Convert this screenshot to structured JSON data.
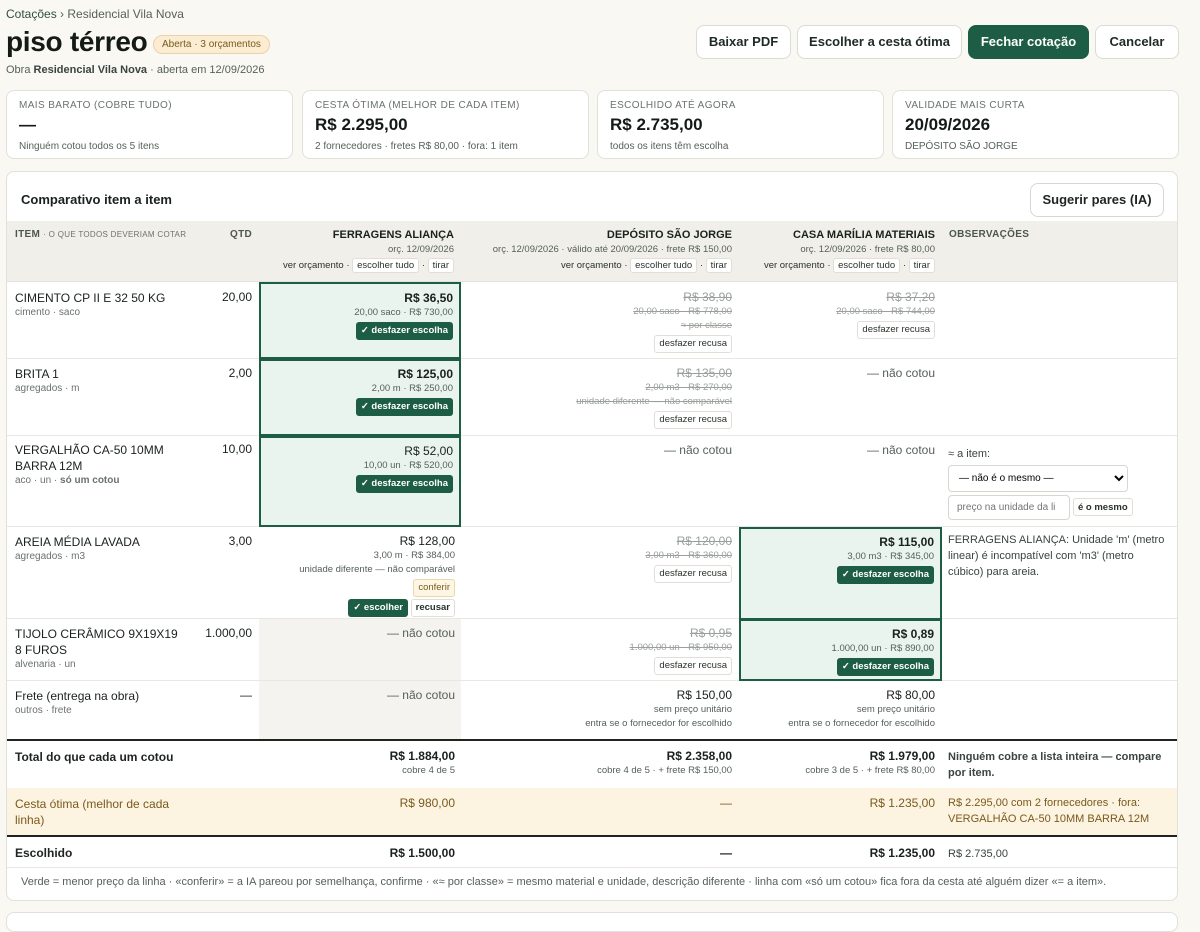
{
  "breadcrumb": {
    "root": "Cotações",
    "sep": "›",
    "current": "Residencial Vila Nova"
  },
  "page": {
    "title": "piso térreo",
    "status_badge": "Aberta · 3 orçamentos",
    "sub_prefix": "Obra",
    "sub_obra": "Residencial Vila Nova",
    "sub_suffix": "· aberta em 12/09/2026"
  },
  "actions": {
    "pdf": "Baixar PDF",
    "best": "Escolher a cesta ótima",
    "close": "Fechar cotação",
    "cancel": "Cancelar"
  },
  "summary": [
    {
      "label": "MAIS BARATO (COBRE TUDO)",
      "value": "—",
      "detail": "Ninguém cotou todos os 5 itens"
    },
    {
      "label": "CESTA ÓTIMA (MELHOR DE CADA ITEM)",
      "value": "R$ 2.295,00",
      "detail": "2 fornecedores · fretes R$ 80,00 · fora: 1 item"
    },
    {
      "label": "ESCOLHIDO ATÉ AGORA",
      "value": "R$ 2.735,00",
      "detail": "todos os itens têm escolha"
    },
    {
      "label": "VALIDADE MAIS CURTA",
      "value": "20/09/2026",
      "detail": "DEPÓSITO SÃO JORGE"
    }
  ],
  "panel": {
    "title": "Comparativo item a item",
    "suggest": "Sugerir pares (IA)"
  },
  "header": {
    "item": "ITEM",
    "item_hint": "· O QUE TODOS DEVERIAM COTAR",
    "qty": "QTD",
    "obs": "OBSERVAÇÕES"
  },
  "suppliers": [
    {
      "name": "FERRAGENS ALIANÇA",
      "meta": "orç. 12/09/2026",
      "view": "ver orçamento",
      "dot": "·",
      "all": "escolher tudo",
      "remove": "tirar"
    },
    {
      "name": "DEPÓSITO SÃO JORGE",
      "meta": "orç. 12/09/2026 · válido até 20/09/2026 · frete R$ 150,00",
      "view": "ver orçamento",
      "dot": "·",
      "all": "escolher tudo",
      "remove": "tirar"
    },
    {
      "name": "CASA MARÍLIA MATERIAIS",
      "meta": "orç. 12/09/2026 · frete R$ 80,00",
      "view": "ver orçamento",
      "dot": "·",
      "all": "escolher tudo",
      "remove": "tirar"
    }
  ],
  "rows": {
    "cimento": {
      "name": "CIMENTO CP II E 32 50 KG",
      "cat": "cimento · saco",
      "qty": "20,00",
      "s1": {
        "price": "R$ 36,50",
        "detail": "20,00 saco · R$ 730,00",
        "action": "✓ desfazer escolha"
      },
      "s2": {
        "price": "R$ 38,90",
        "detail": "20,00 saco · R$ 778,00",
        "note": "≈ por classe",
        "action": "desfazer recusa"
      },
      "s3": {
        "price": "R$ 37,20",
        "detail": "20,00 saco · R$ 744,00",
        "action": "desfazer recusa"
      }
    },
    "brita": {
      "name": "BRITA 1",
      "cat": "agregados · m",
      "qty": "2,00",
      "s1": {
        "price": "R$ 125,00",
        "detail": "2,00 m · R$ 250,00",
        "action": "✓ desfazer escolha"
      },
      "s2": {
        "price": "R$ 135,00",
        "detail": "2,00 m3 · R$ 270,00",
        "note": "unidade diferente — não comparável",
        "action": "desfazer recusa"
      },
      "s3": {
        "none": "— não cotou"
      }
    },
    "vergalhao": {
      "name": "VERGALHÃO CA-50 10MM BARRA 12M",
      "cat": "aco · un ·",
      "cat_bold": "só um cotou",
      "qty": "10,00",
      "s1": {
        "price": "R$ 52,00",
        "detail": "10,00 un · R$ 520,00",
        "action": "✓ desfazer escolha"
      },
      "s2": {
        "none": "— não cotou"
      },
      "s3": {
        "none": "— não cotou"
      },
      "obs": {
        "label": "≈ a item:",
        "select": "— não é o mesmo —",
        "placeholder": "preço na unidade da li",
        "btn": "é o mesmo"
      }
    },
    "areia": {
      "name": "AREIA MÉDIA LAVADA",
      "cat": "agregados · m3",
      "qty": "3,00",
      "s1": {
        "price": "R$ 128,00",
        "detail": "3,00 m · R$ 384,00",
        "note": "unidade diferente — não comparável",
        "confirm": "conferir",
        "choose": "✓ escolher",
        "refuse": "recusar"
      },
      "s2": {
        "price": "R$ 120,00",
        "detail": "3,00 m3 · R$ 360,00",
        "action": "desfazer recusa"
      },
      "s3": {
        "price": "R$ 115,00",
        "detail": "3,00 m3 · R$ 345,00",
        "action": "✓ desfazer escolha"
      },
      "obs": "FERRAGENS ALIANÇA: Unidade 'm' (metro linear) é incompatível com 'm3' (metro cúbico) para areia."
    },
    "tijolo": {
      "name": "TIJOLO CERÂMICO 9X19X19 8 FUROS",
      "cat": "alvenaria · un",
      "qty": "1.000,00",
      "s1": {
        "none": "— não cotou"
      },
      "s2": {
        "price": "R$ 0,95",
        "detail": "1.000,00 un · R$ 950,00",
        "action": "desfazer recusa"
      },
      "s3": {
        "price": "R$ 0,89",
        "detail": "1.000,00 un · R$ 890,00",
        "action": "✓ desfazer escolha"
      }
    },
    "frete": {
      "name": "Frete (entrega na obra)",
      "cat": "outros · frete",
      "qty": "—",
      "s1": {
        "none": "— não cotou"
      },
      "s2": {
        "price": "R$ 150,00",
        "l1": "sem preço unitário",
        "l2": "entra se o fornecedor for escolhido"
      },
      "s3": {
        "price": "R$ 80,00",
        "l1": "sem preço unitário",
        "l2": "entra se o fornecedor for escolhido"
      }
    }
  },
  "totals": {
    "label": "Total do que cada um cotou",
    "s1": {
      "value": "R$ 1.884,00",
      "detail": "cobre 4 de 5"
    },
    "s2": {
      "value": "R$ 2.358,00",
      "detail": "cobre 4 de 5 · + frete R$ 150,00"
    },
    "s3": {
      "value": "R$ 1.979,00",
      "detail": "cobre 3 de 5 · + frete R$ 80,00"
    },
    "obs": "Ninguém cobre a lista inteira — compare por item."
  },
  "best": {
    "label": "Cesta ótima (melhor de cada linha)",
    "s1": "R$ 980,00",
    "s2": "—",
    "s3": "R$ 1.235,00",
    "obs": "R$ 2.295,00 com 2 fornecedores · fora: VERGALHÃO CA-50 10MM BARRA 12M"
  },
  "chosen": {
    "label": "Escolhido",
    "s1": "R$ 1.500,00",
    "s2": "—",
    "s3": "R$ 1.235,00",
    "obs": "R$ 2.735,00"
  },
  "footer": "Verde = menor preço da linha · «conferir» = a IA pareou por semelhança, confirme · «≈ por classe» = mesmo material e unidade, descrição diferente · linha com «só um cotou» fica fora da cesta até alguém dizer «= a item».",
  "colors": {
    "accent": "#1d5d45",
    "selected_bg": "#e9f4ee",
    "best_row_bg": "#fcf3e1",
    "badge_bg": "#fbecd2"
  }
}
